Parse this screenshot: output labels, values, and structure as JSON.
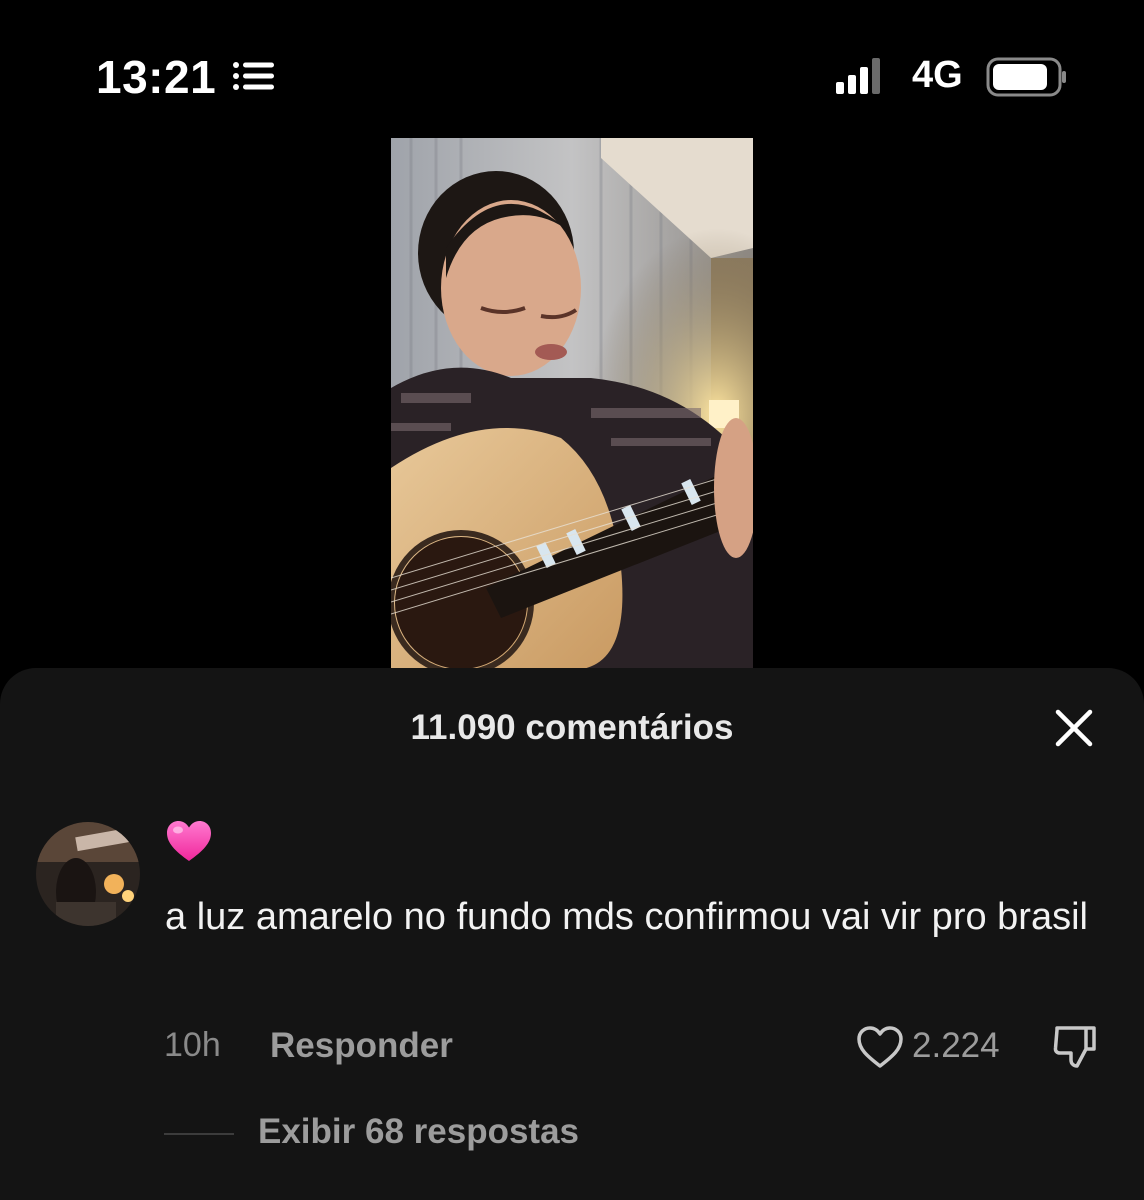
{
  "status_bar": {
    "time": "13:21",
    "network": "4G",
    "icons": [
      "notification-list-icon",
      "signal-icon",
      "battery-icon"
    ]
  },
  "video": {
    "description_icon": "video-thumbnail"
  },
  "comments": {
    "title": "11.090 comentários",
    "close_icon": "close-icon",
    "item": {
      "badge_icon": "pink-heart-emoji",
      "text": "a luz amarelo no fundo mds confirmou vai vir pro brasil",
      "time": "10h",
      "reply_label": "Responder",
      "like_count": "2.224",
      "view_replies_label": "Exibir 68 respostas"
    }
  },
  "colors": {
    "background": "#000000",
    "sheet": "#141414",
    "muted_text": "#9c9c9c",
    "heart": "#ff3fae"
  }
}
